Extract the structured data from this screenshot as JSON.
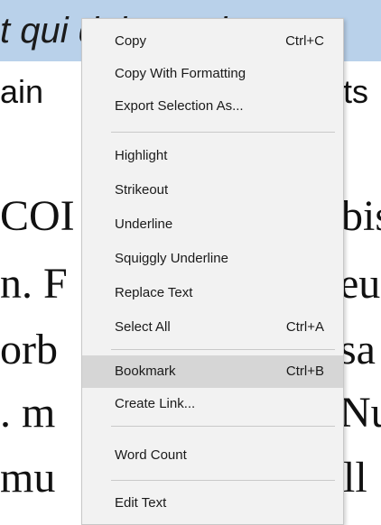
{
  "document": {
    "line1": "t qui dolorem ipsu",
    "line2": "ain",
    "line2b": "ts",
    "line3a": "COI",
    "line3b": "bis",
    "line4a": "n. F",
    "line4b": "eu",
    "line5a": "orb",
    "line5b": "sa",
    "line6a": ". m",
    "line6b": "Nu",
    "line7a": "mu",
    "line7b": "ll"
  },
  "context_menu": {
    "items": [
      {
        "label": "Copy",
        "shortcut": "Ctrl+C"
      },
      {
        "label": "Copy With Formatting",
        "shortcut": ""
      },
      {
        "label": "Export Selection As...",
        "shortcut": ""
      },
      {
        "label": "Highlight",
        "shortcut": ""
      },
      {
        "label": "Strikeout",
        "shortcut": ""
      },
      {
        "label": "Underline",
        "shortcut": ""
      },
      {
        "label": "Squiggly Underline",
        "shortcut": ""
      },
      {
        "label": "Replace Text",
        "shortcut": ""
      },
      {
        "label": "Select All",
        "shortcut": "Ctrl+A"
      },
      {
        "label": "Bookmark",
        "shortcut": "Ctrl+B",
        "highlighted": true
      },
      {
        "label": "Create Link...",
        "shortcut": ""
      },
      {
        "label": "Word Count",
        "shortcut": ""
      },
      {
        "label": "Edit Text",
        "shortcut": ""
      }
    ]
  }
}
